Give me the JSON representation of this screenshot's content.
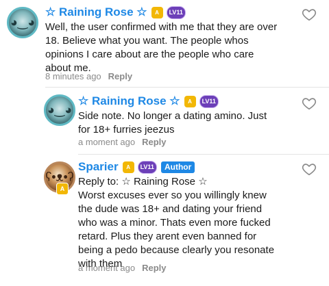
{
  "comments": [
    {
      "author": "☆ Raining Rose ☆",
      "text": "Well, the user confirmed with me that they are over\n18. Believe what you want. The people whos\nopinions I care about are the people who care\nabout me.",
      "time": "8 minutes ago",
      "reply_label": "Reply",
      "badge_gold": "A",
      "badge_level": "LV11"
    },
    {
      "author": "☆ Raining Rose ☆",
      "text": "Side note. No longer a dating amino. Just\nfor 18+ furries jeezus",
      "time": "a moment ago",
      "reply_label": "Reply",
      "badge_gold": "A",
      "badge_level": "LV11"
    },
    {
      "author": "Sparier",
      "reply_to": "Reply to: ☆ Raining Rose ☆",
      "text": "Worst excuses ever so you willingly knew\nthe dude was 18+ and dating your friend\nwho was a minor. Thats even more fucked\nretard. Plus they arent even banned for\nbeing a pedo because clearly you resonate\nwith them",
      "time": "a moment ago",
      "reply_label": "Reply",
      "badge_gold": "A",
      "badge_level": "LV11",
      "author_tag": "Author"
    }
  ],
  "icons": {
    "like": "heart-outline-icon"
  },
  "colors": {
    "username": "#1e88e5",
    "level_badge": "#6c3fb8",
    "gold_badge": "#f2b705"
  }
}
